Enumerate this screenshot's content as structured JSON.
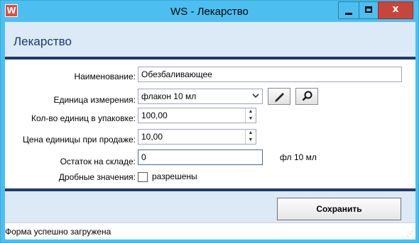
{
  "window": {
    "title": "WS - Лекарство",
    "icon_letter": "W",
    "close_glyph": "x"
  },
  "header": {
    "title": "Лекарство"
  },
  "form": {
    "name_label": "Наименование:",
    "name_value": "Обезбаливающее",
    "unit_label": "Единица измерения:",
    "unit_value": "флакон 10 мл",
    "pack_label": "Кол-во единиц в упаковке:",
    "pack_value": "100,00",
    "price_label": "Цена единицы при продаже:",
    "price_value": "10,00",
    "stock_label": "Остаток на складе:",
    "stock_value": "0",
    "stock_unit": "фл 10 мл",
    "fraction_label": "Дробные значения:",
    "fraction_checkbox_label": "разрешены",
    "fraction_checked": false
  },
  "footer": {
    "save_label": "Сохранить"
  },
  "statusbar": {
    "text": "Форма успешно загружена"
  },
  "icons": {
    "app": "app-icon",
    "edit": "pencil-icon",
    "search": "magnifier-icon",
    "dropdown": "chevron-down-icon",
    "spin_up": "spin-up-icon",
    "spin_down": "spin-down-icon"
  },
  "colors": {
    "titlebar": "#4cbff0",
    "close_button": "#c7463c",
    "header_bg": "#dce9f6",
    "rule": "#1e3a6e",
    "header_title": "#1a3a6a"
  }
}
